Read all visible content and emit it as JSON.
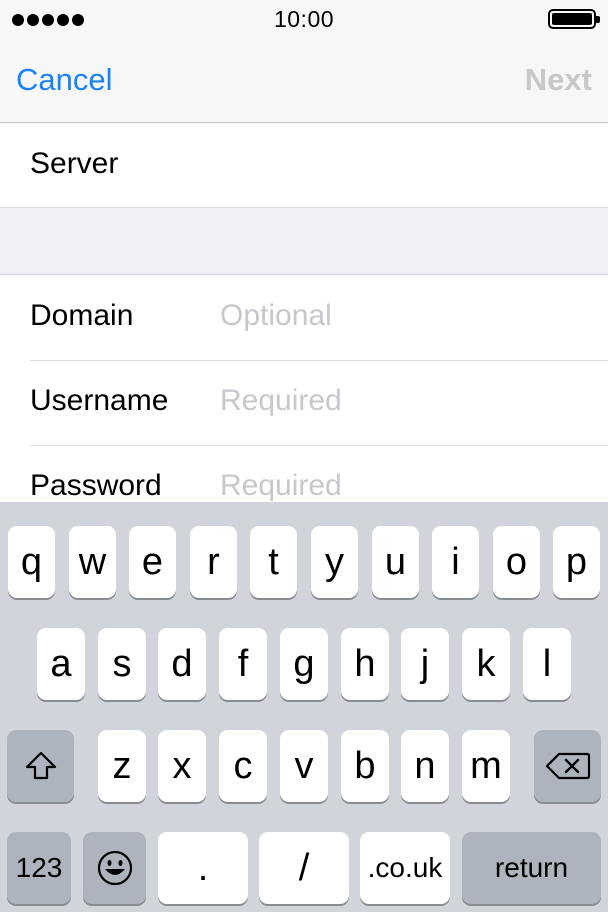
{
  "status_bar": {
    "time": "10:00"
  },
  "nav": {
    "cancel_label": "Cancel",
    "next_label": "Next"
  },
  "form": {
    "server_label": "Server",
    "fields": [
      {
        "label": "Domain",
        "placeholder": "Optional"
      },
      {
        "label": "Username",
        "placeholder": "Required"
      },
      {
        "label": "Password",
        "placeholder": "Required"
      }
    ]
  },
  "keyboard": {
    "row1": [
      "q",
      "w",
      "e",
      "r",
      "t",
      "y",
      "u",
      "i",
      "o",
      "p"
    ],
    "row2": [
      "a",
      "s",
      "d",
      "f",
      "g",
      "h",
      "j",
      "k",
      "l"
    ],
    "row3": [
      "z",
      "x",
      "c",
      "v",
      "b",
      "n",
      "m"
    ],
    "numbers_label": "123",
    "dot_label": ".",
    "slash_label": "/",
    "domain_label": ".co.uk",
    "return_label": "return",
    "shift_icon": "shift-icon",
    "delete_icon": "delete-icon",
    "emoji_icon": "emoji-icon"
  }
}
